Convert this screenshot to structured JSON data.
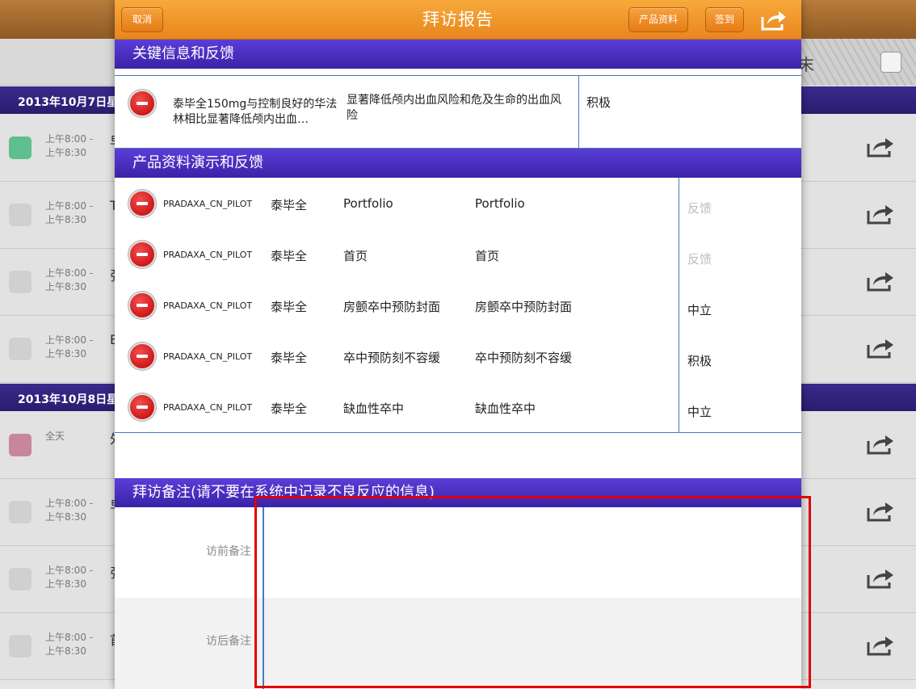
{
  "background": {
    "toolbar_char": "末",
    "date_headers": [
      "2013年10月7日星",
      "2013年10月8日星"
    ],
    "rows": [
      {
        "color": "#5fbf8f",
        "time1": "上午8:00 -",
        "time2": "上午8:30",
        "first": "早"
      },
      {
        "color": "#d0d0d0",
        "time1": "上午8:00 -",
        "time2": "上午8:30",
        "first": "T"
      },
      {
        "color": "#d0d0d0",
        "time1": "上午8:00 -",
        "time2": "上午8:30",
        "first": "张"
      },
      {
        "color": "#d0d0d0",
        "time1": "上午8:00 -",
        "time2": "上午8:30",
        "first": "B"
      },
      {
        "color": "#c7879a",
        "time1": "全天",
        "time2": "",
        "first": "外"
      },
      {
        "color": "#d0d0d0",
        "time1": "上午8:00 -",
        "time2": "上午8:30",
        "first": "早"
      },
      {
        "color": "#d0d0d0",
        "time1": "上午8:00 -",
        "time2": "上午8:30",
        "first": "张"
      },
      {
        "color": "#d0d0d0",
        "time1": "上午8:00 -",
        "time2": "上午8:30",
        "first": "首"
      }
    ]
  },
  "modal": {
    "title": "拜访报告",
    "cancel_label": "取消",
    "product_info_label": "产品资料",
    "checkin_label": "签到",
    "key_feedback_title": "关键信息和反馈",
    "key_feedback": {
      "message": "泰毕全150mg与控制良好的华法林相比显著降低颅内出血…",
      "benefit": "显著降低颅内出血风险和危及生命的出血风险",
      "reaction": "积极"
    },
    "product_demo_title": "产品资料演示和反馈",
    "products": [
      {
        "code": "PRADAXA_CN_PILOT",
        "product": "泰毕全",
        "slide": "Portfolio",
        "page": "Portfolio",
        "feedback": "反馈",
        "placeholder": true
      },
      {
        "code": "PRADAXA_CN_PILOT",
        "product": "泰毕全",
        "slide": "首页",
        "page": "首页",
        "feedback": "反馈",
        "placeholder": true
      },
      {
        "code": "PRADAXA_CN_PILOT",
        "product": "泰毕全",
        "slide": "房颤卒中预防封面",
        "page": "房颤卒中预防封面",
        "feedback": "中立",
        "placeholder": false
      },
      {
        "code": "PRADAXA_CN_PILOT",
        "product": "泰毕全",
        "slide": "卒中预防刻不容缓",
        "page": "卒中预防刻不容缓",
        "feedback": "积极",
        "placeholder": false
      },
      {
        "code": "PRADAXA_CN_PILOT",
        "product": "泰毕全",
        "slide": "缺血性卒中",
        "page": "缺血性卒中",
        "feedback": "中立",
        "placeholder": false
      }
    ],
    "notes_title": "拜访备注(请不要在系统中记录不良反应的信息)",
    "pre_note_label": "访前备注",
    "post_note_label": "访后备注",
    "pre_note_value": "",
    "post_note_value": ""
  },
  "colors": {
    "header_orange": "#f08f26",
    "section_purple": "#4a2fc2",
    "divider_blue": "#4a77c8",
    "highlight_red": "#e00000"
  }
}
